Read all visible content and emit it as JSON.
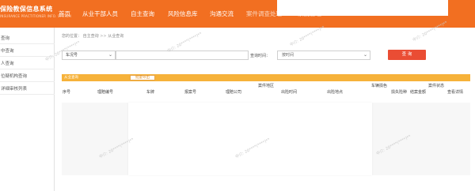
{
  "header": {
    "brand_title": "保险教保信息系统",
    "brand_subtitle": "INSURANCE PRACTITIONER INFO. SYSTEM",
    "nav": [
      "首页",
      "从业干部人员",
      "自主查询",
      "风险信息库",
      "沟通交流",
      "案件调查处理",
      "系统管理"
    ]
  },
  "sidebar": {
    "items": [
      "查询",
      "中查询",
      "人查询",
      "位疑机构查询",
      "详细审核列表"
    ]
  },
  "breadcrumb": {
    "prefix": "您的位置：",
    "items": [
      "自主查询",
      "从业查询"
    ],
    "separator": ">>"
  },
  "filters": {
    "type_select": "车况号",
    "query_time_label": "查询时间：",
    "query_time_select": "按时间",
    "query_button": "查 询"
  },
  "results": {
    "title": "从业查询",
    "export_button": "批量导出",
    "columns": [
      "序号",
      "理赔编号",
      "车牌",
      "报案号",
      "理赔公司",
      "案件地区",
      "出险时间",
      "出险地点",
      "车辆损色",
      "损失险种",
      "结案金额",
      "案件状态",
      "查看详情"
    ]
  },
  "watermark": {
    "text": "中介: 20****(****)**"
  },
  "colors": {
    "header": "#f26f21",
    "accent_bar": "#f6b23a",
    "query_button": "#ea4d34"
  }
}
